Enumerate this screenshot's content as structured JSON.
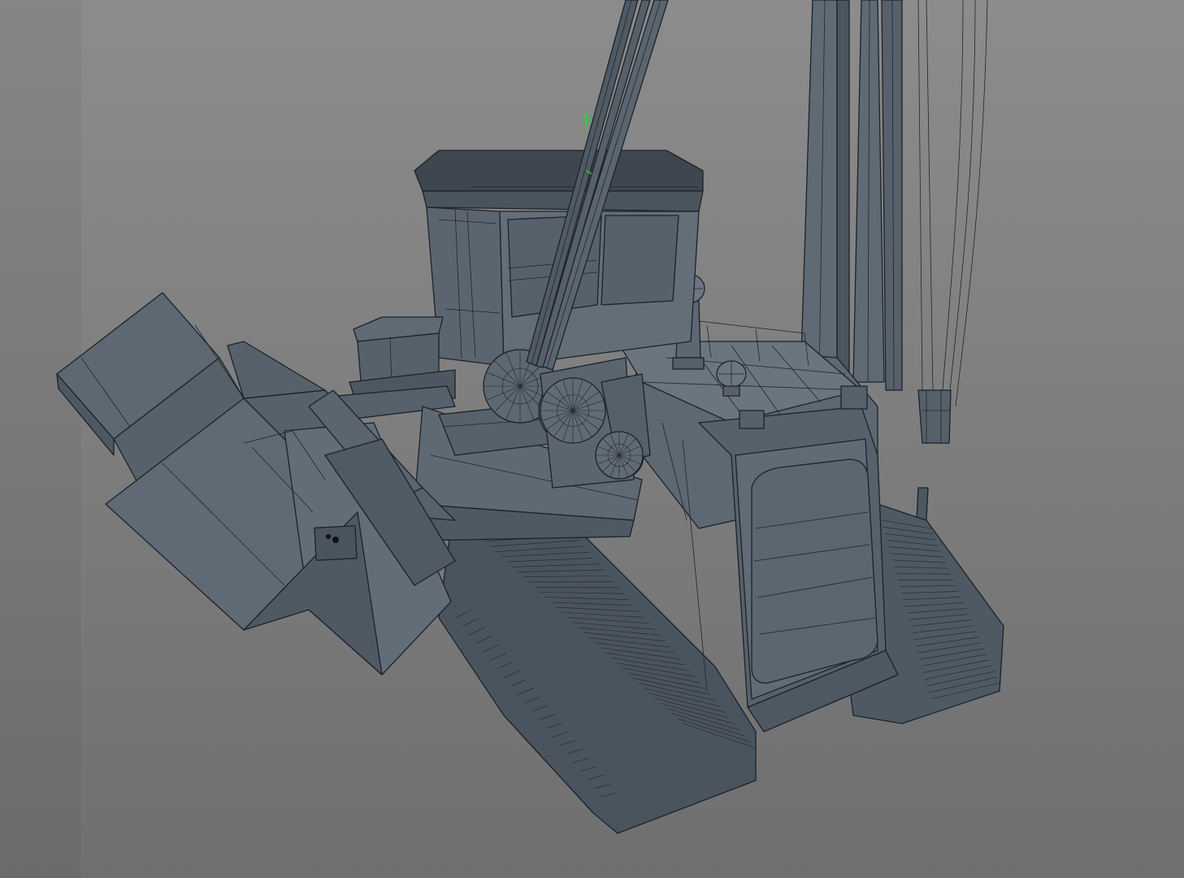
{
  "viewport": {
    "background_top": "#8c8c8c",
    "background_bottom": "#6f6f6f",
    "mesh_fill": "#5a6570",
    "mesh_fill_light": "#6b7681",
    "mesh_fill_dark": "#47515a",
    "wire_color": "#1c2228",
    "gizmo_color": "#2ecc40"
  },
  "scene": {
    "model": "pipelayer-crawler-tractor",
    "shading": "wireframe-on-shaded"
  },
  "icons": {
    "gizmo": "manipulator-pivot-icon"
  }
}
